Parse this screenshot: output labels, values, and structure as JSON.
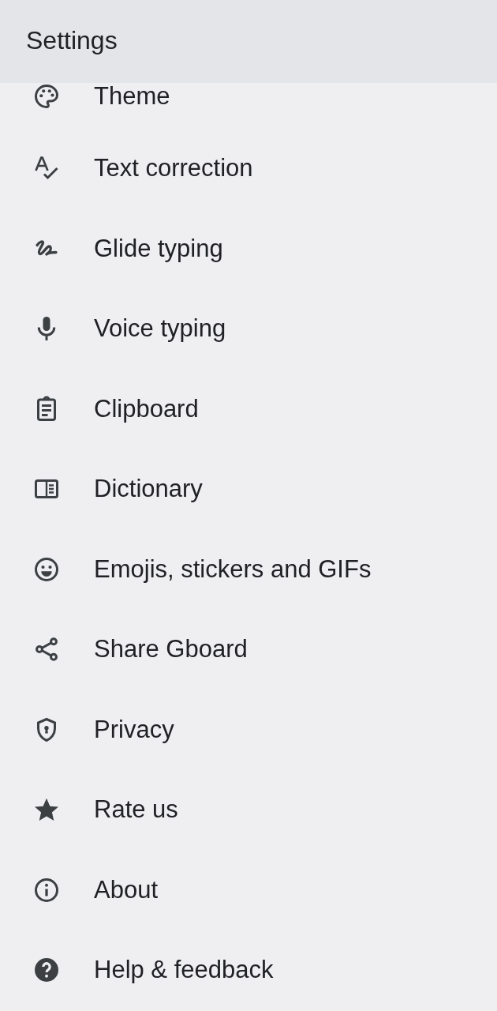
{
  "header": {
    "title": "Settings"
  },
  "items": [
    {
      "label": "Theme"
    },
    {
      "label": "Text correction"
    },
    {
      "label": "Glide typing"
    },
    {
      "label": "Voice typing"
    },
    {
      "label": "Clipboard"
    },
    {
      "label": "Dictionary"
    },
    {
      "label": "Emojis, stickers and GIFs"
    },
    {
      "label": "Share Gboard"
    },
    {
      "label": "Privacy"
    },
    {
      "label": "Rate us"
    },
    {
      "label": "About"
    },
    {
      "label": "Help & feedback"
    }
  ]
}
